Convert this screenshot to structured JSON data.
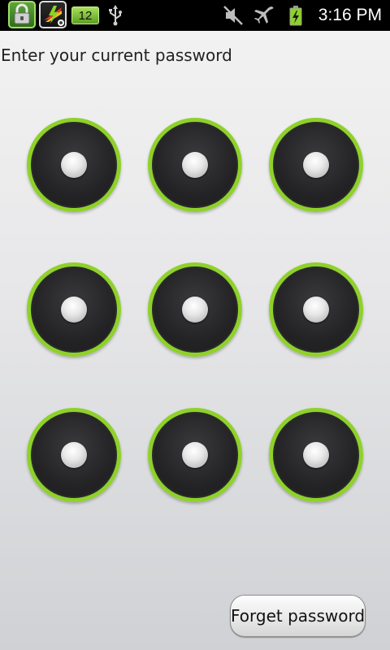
{
  "status_bar": {
    "notification_count": "12",
    "time": "3:16 PM",
    "icons": [
      "lock-app-icon",
      "battery-app-icon",
      "usb-icon",
      "mute-icon",
      "airplane-mode-icon",
      "battery-charging-icon"
    ]
  },
  "prompt": "Enter your current password",
  "pattern": {
    "rows": 3,
    "cols": 3
  },
  "forget_button_label": "Forget password",
  "colors": {
    "accent_ring": "#8ed12a",
    "node_fill": "#232325",
    "status_bar_bg": "#000000"
  }
}
